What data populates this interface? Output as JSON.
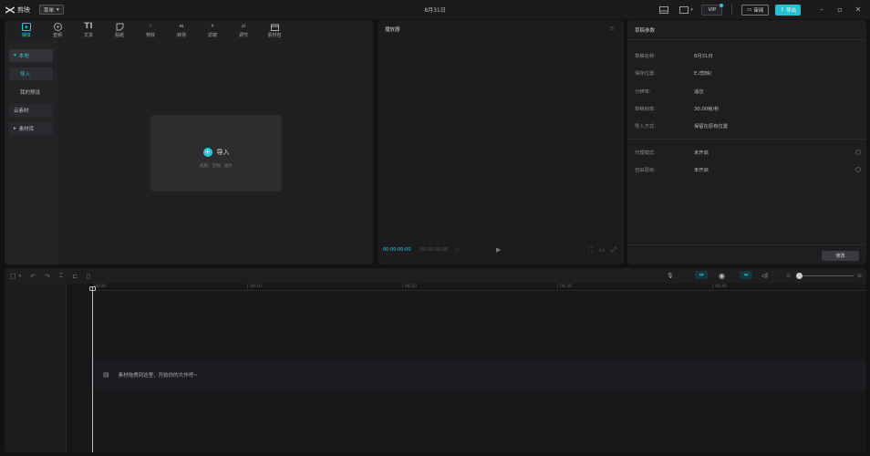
{
  "app": {
    "title": "剪映",
    "menu_label": "菜单",
    "doc_title": "8月31日"
  },
  "header": {
    "vip": "VIP",
    "share": "审阅",
    "export": "导出"
  },
  "toolbar": {
    "tabs": [
      {
        "label": "媒体",
        "icon": "media-icon",
        "active": true
      },
      {
        "label": "音频",
        "icon": "audio-icon"
      },
      {
        "label": "文本",
        "icon": "text-icon"
      },
      {
        "label": "贴纸",
        "icon": "sticker-icon"
      },
      {
        "label": "特效",
        "icon": "effects-icon"
      },
      {
        "label": "转场",
        "icon": "transition-icon"
      },
      {
        "label": "滤镜",
        "icon": "filter-icon"
      },
      {
        "label": "调节",
        "icon": "adjust-icon"
      },
      {
        "label": "素材包",
        "icon": "package-icon"
      }
    ]
  },
  "sidebar": {
    "items": [
      "本地",
      "导入",
      "我的预设",
      "云素材",
      "素材库"
    ]
  },
  "import": {
    "label": "导入",
    "sub": "视频、音频、图片"
  },
  "player": {
    "title": "播放器",
    "time_current": "00:00:00:00",
    "time_total": "00:00:00:00"
  },
  "draft": {
    "title": "草稿参数",
    "rows": [
      {
        "k": "草稿名称:",
        "v": "8月31日"
      },
      {
        "k": "保存位置:",
        "v": "E:/剪映/"
      },
      {
        "k": "分辨率:",
        "v": "适应"
      },
      {
        "k": "草稿帧率:",
        "v": "30.00帧/秒"
      },
      {
        "k": "导入方式:",
        "v": "保留在原有位置"
      }
    ],
    "rows2": [
      {
        "k": "代理模式:",
        "v": "未开启"
      },
      {
        "k": "自由层级:",
        "v": "未开启"
      }
    ],
    "modify": "修改"
  },
  "timeline": {
    "ticks": [
      "00:00",
      "| 00:10",
      "| 00:20",
      "| 00:30",
      "| 00:40"
    ],
    "hint": "素材拖拽到这里，开始你的大作吧~",
    "zoom": 0.0
  },
  "colors": {
    "accent": "#2ec7d6"
  }
}
